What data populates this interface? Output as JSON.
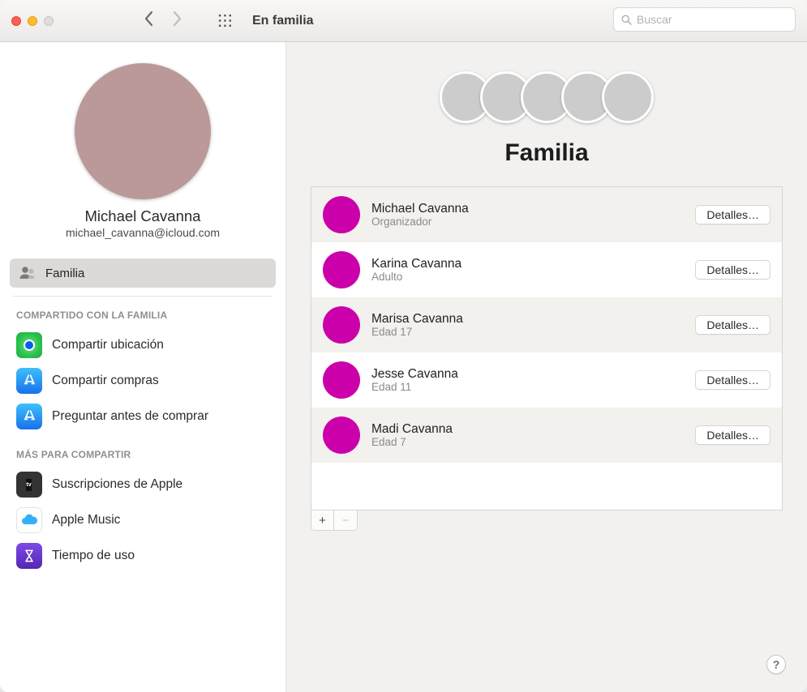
{
  "titlebar": {
    "title": "En familia",
    "search_placeholder": "Buscar"
  },
  "sidebar": {
    "profile": {
      "name": "Michael Cavanna",
      "email": "michael_cavanna@icloud.com"
    },
    "selected": {
      "label": "Familia"
    },
    "section_shared_title": "COMPARTIDO CON LA FAMILIA",
    "shared_items": [
      {
        "label": "Compartir ubicación",
        "icon": "findmy"
      },
      {
        "label": "Compartir compras",
        "icon": "appstore"
      },
      {
        "label": "Preguntar antes de comprar",
        "icon": "appstore"
      }
    ],
    "section_more_title": "MÁS PARA COMPARTIR",
    "more_items": [
      {
        "label": "Suscripciones de Apple",
        "icon": "subs"
      },
      {
        "label": "Apple Music",
        "icon": "icloud"
      },
      {
        "label": "Tiempo de uso",
        "icon": "screentime"
      }
    ]
  },
  "main": {
    "heading": "Familia",
    "details_button": "Detalles…",
    "members": [
      {
        "name": "Michael Cavanna",
        "role": "Organizador",
        "avatar": "bg1"
      },
      {
        "name": "Karina Cavanna",
        "role": "Adulto",
        "avatar": "bg2"
      },
      {
        "name": "Marisa Cavanna",
        "role": "Edad 17",
        "avatar": "bg3"
      },
      {
        "name": "Jesse Cavanna",
        "role": "Edad 11",
        "avatar": "bg4"
      },
      {
        "name": "Madi Cavanna",
        "role": "Edad 7",
        "avatar": "bg5"
      }
    ],
    "add_label": "+",
    "remove_label": "−",
    "help_label": "?"
  }
}
